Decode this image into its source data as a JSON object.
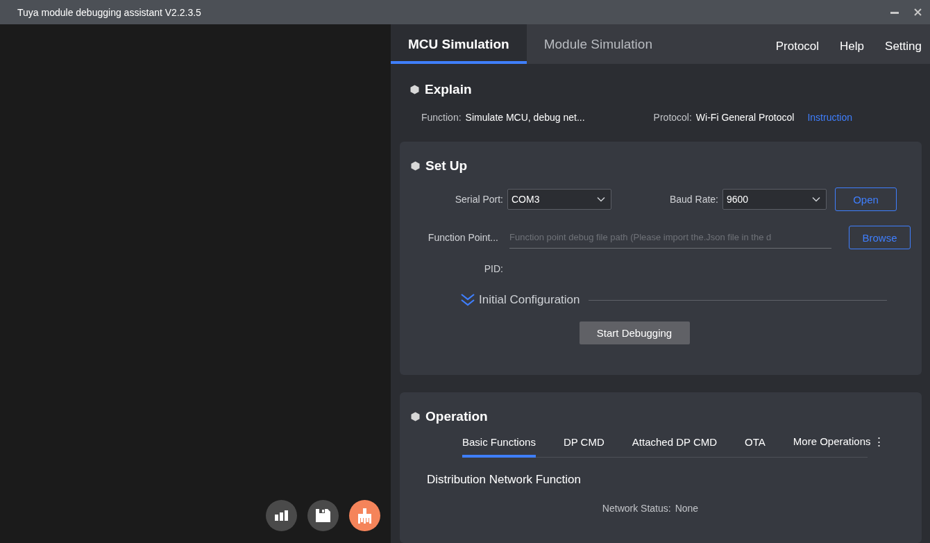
{
  "window": {
    "title": "Tuya module debugging assistant V2.2.3.5"
  },
  "tool_buttons": [
    {
      "kind": "chart",
      "color": "#4a4a4a"
    },
    {
      "kind": "save",
      "color": "#4a4a4a"
    },
    {
      "kind": "brush",
      "color": "#f5845a"
    }
  ],
  "tabs": [
    {
      "label": "MCU Simulation",
      "selected": true
    },
    {
      "label": "Module Simulation",
      "selected": false
    }
  ],
  "menu": [
    "Protocol",
    "Help",
    "Setting"
  ],
  "explain": {
    "title": "Explain",
    "function_label": "Function:",
    "function_value": "Simulate MCU, debug net...",
    "protocol_label": "Protocol:",
    "protocol_value": "Wi-Fi General Protocol",
    "link": "Instruction"
  },
  "setup": {
    "title": "Set Up",
    "serial_port": {
      "label": "Serial Port:",
      "value": "COM3"
    },
    "baud_rate": {
      "label": "Baud Rate:",
      "value": "9600"
    },
    "open_button": "Open",
    "function_point": {
      "label": "Function Point...",
      "placeholder": "Function point debug file path (Please import the.Json file in the d"
    },
    "browse_button": "Browse",
    "pid_label": "PID:",
    "initial_configuration": {
      "label": "Initial Configuration",
      "expanded": false
    },
    "start_button": "Start Debugging"
  },
  "operation": {
    "title": "Operation",
    "tabs": [
      {
        "label": "Basic Functions",
        "selected": true
      },
      {
        "label": "DP CMD",
        "selected": false
      },
      {
        "label": "Attached DP CMD",
        "selected": false
      },
      {
        "label": "OTA",
        "selected": false
      },
      {
        "label": "More Operations ⋮",
        "selected": false
      }
    ],
    "section_title": "Distribution Network Function",
    "network_status": {
      "label": "Network Status:",
      "value": "None"
    }
  }
}
